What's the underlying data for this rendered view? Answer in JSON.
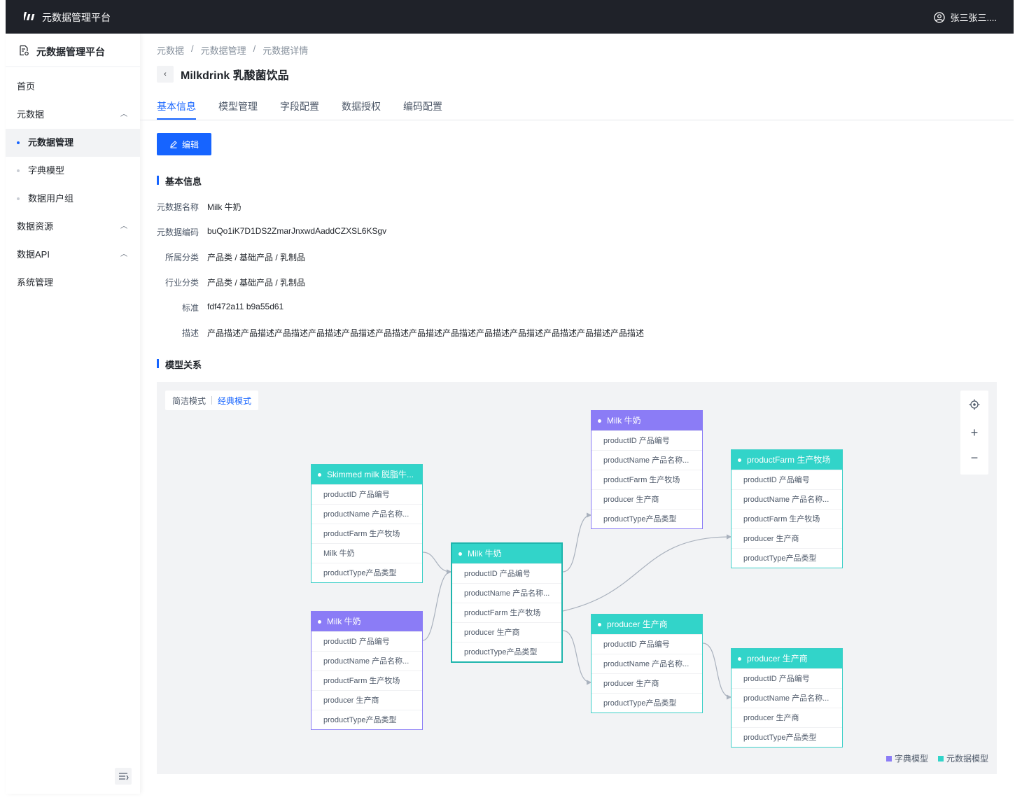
{
  "topbar": {
    "app_title": "元数据管理平台",
    "user_name": "张三张三...."
  },
  "sidebar": {
    "title": "元数据管理平台",
    "items": [
      {
        "label": "首页"
      },
      {
        "label": "元数据"
      },
      {
        "label": "元数据管理"
      },
      {
        "label": "字典模型"
      },
      {
        "label": "数据用户组"
      },
      {
        "label": "数据资源"
      },
      {
        "label": "数据API"
      },
      {
        "label": "系统管理"
      }
    ]
  },
  "breadcrumb": [
    "元数据",
    "元数据管理",
    "元数据详情"
  ],
  "breadcrumb_sep": "/",
  "page_title": "Milkdrink 乳酸菌饮品",
  "tabs": [
    "基本信息",
    "模型管理",
    "字段配置",
    "数据授权",
    "编码配置"
  ],
  "edit_label": "编辑",
  "basic_section": "基本信息",
  "info": [
    {
      "label": "元数据名称",
      "value": "Milk 牛奶"
    },
    {
      "label": "元数据编码",
      "value": "buQo1iK7D1DS2ZmarJnxwdAaddCZXSL6KSgv"
    },
    {
      "label": "所属分类",
      "value": "产品类 / 基础产品 / 乳制品"
    },
    {
      "label": "行业分类",
      "value": "产品类 / 基础产品 / 乳制品"
    },
    {
      "label": "标准",
      "value": "fdf472a11 b9a55d61"
    },
    {
      "label": "描述",
      "value": "产品描述产品描述产品描述产品描述产品描述产品描述产品描述产品描述产品描述产品描述产品描述产品描述产品描述"
    }
  ],
  "model_section": "模型关系",
  "graph": {
    "mode_simple": "简洁模式",
    "mode_classic": "经典模式",
    "zoom_plus": "+",
    "zoom_minus": "−",
    "legend_dict": "字典模型",
    "legend_meta": "元数据模型",
    "colors": {
      "dict": "#8b7cf6",
      "meta": "#32d4c9",
      "accent": "#1664ff"
    },
    "nodes": [
      {
        "title": "Skimmed milk 脱脂牛...",
        "kind": "meta",
        "fields": [
          "productID 产品编号",
          "productName 产品名称...",
          "productFarm 生产牧场",
          "Milk 牛奶",
          "productType产品类型"
        ]
      },
      {
        "title": "Milk 牛奶",
        "kind": "dict",
        "fields": [
          "productID 产品编号",
          "productName 产品名称...",
          "productFarm 生产牧场",
          "producer 生产商",
          "productType产品类型"
        ]
      },
      {
        "title": "Milk 牛奶",
        "kind": "meta",
        "fields": [
          "productID 产品编号",
          "productName 产品名称...",
          "productFarm 生产牧场",
          "producer 生产商",
          "productType产品类型"
        ]
      },
      {
        "title": "Milk 牛奶",
        "kind": "dict",
        "fields": [
          "productID 产品编号",
          "productName 产品名称...",
          "productFarm 生产牧场",
          "producer 生产商",
          "productType产品类型"
        ]
      },
      {
        "title": "producer 生产商",
        "kind": "meta",
        "fields": [
          "productID 产品编号",
          "productName 产品名称...",
          "producer 生产商",
          "productType产品类型"
        ]
      },
      {
        "title": "productFarm 生产牧场",
        "kind": "meta",
        "fields": [
          "productID 产品编号",
          "productName 产品名称...",
          "productFarm 生产牧场",
          "producer 生产商",
          "productType产品类型"
        ]
      },
      {
        "title": "producer 生产商",
        "kind": "meta",
        "fields": [
          "productID 产品编号",
          "productName 产品名称...",
          "producer 生产商",
          "productType产品类型"
        ]
      }
    ]
  }
}
